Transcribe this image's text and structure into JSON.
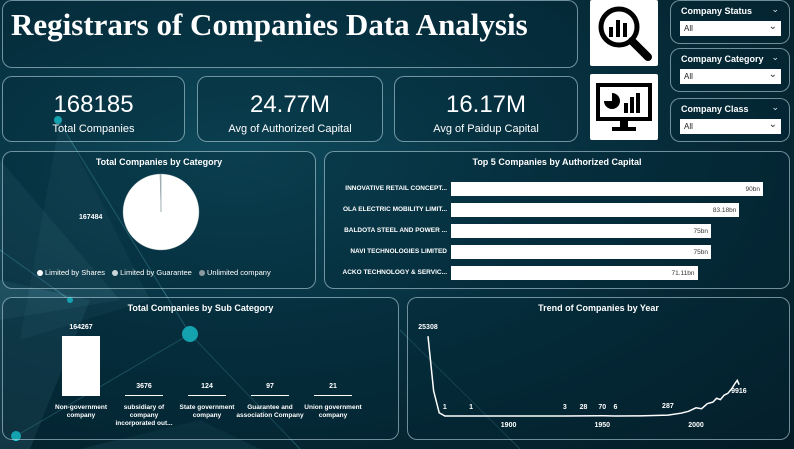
{
  "title": "Registrars of Companies Data Analysis",
  "slicers": [
    {
      "label": "Company Status",
      "value": "All"
    },
    {
      "label": "Company Category",
      "value": "All"
    },
    {
      "label": "Company Class",
      "value": "All"
    }
  ],
  "kpis": [
    {
      "value": "168185",
      "label": "Total Companies"
    },
    {
      "value": "24.77M",
      "label": "Avg of Authorized Capital"
    },
    {
      "value": "16.17M",
      "label": "Avg of Paidup Capital"
    }
  ],
  "colors": {
    "accent": "#ffffff",
    "background": "#07303f",
    "glow": "#1fe3f0"
  },
  "chart_data": [
    {
      "type": "pie",
      "title": "Total Companies by Category",
      "data_label": "167484",
      "slices": [
        {
          "name": "Limited by Shares",
          "value": 167484
        },
        {
          "name": "Limited by Guarantee",
          "value": 601
        },
        {
          "name": "Unlimited company",
          "value": 100
        }
      ],
      "legend_position": "bottom"
    },
    {
      "type": "bar",
      "orientation": "horizontal",
      "title": "Top 5 Companies by Authorized Capital",
      "categories": [
        "INNOVATIVE RETAIL CONCEPT...",
        "OLA ELECTRIC MOBILITY LIMIT...",
        "BALDOTA STEEL AND POWER ...",
        "NAVI TECHNOLOGIES LIMITED",
        "ACKO TECHNOLOGY & SERVIC..."
      ],
      "values": [
        90,
        83.18,
        75,
        75,
        71.11
      ],
      "labels": [
        "90bn",
        "83.18bn",
        "75bn",
        "75bn",
        "71.11bn"
      ],
      "xlim": [
        0,
        90
      ]
    },
    {
      "type": "bar",
      "title": "Total Companies by Sub Category",
      "categories": [
        "Non-government company",
        "subsidiary of company incorporated out...",
        "State government company",
        "Guarantee and association Company",
        "Union government company"
      ],
      "values": [
        164267,
        3676,
        124,
        97,
        21
      ],
      "labels": [
        "164267",
        "3676",
        "124",
        "97",
        "21"
      ]
    },
    {
      "type": "line",
      "title": "Trend of Companies by Year",
      "x_ticks": [
        "1900",
        "1950",
        "2000"
      ],
      "xlim": [
        1857,
        2024
      ],
      "points": [
        [
          1857,
          25308
        ],
        [
          1860,
          8000
        ],
        [
          1863,
          1000
        ],
        [
          1866,
          1
        ],
        [
          1870,
          0
        ],
        [
          1880,
          1
        ],
        [
          1890,
          0
        ],
        [
          1900,
          0
        ],
        [
          1912,
          1
        ],
        [
          1930,
          3
        ],
        [
          1940,
          28
        ],
        [
          1950,
          70
        ],
        [
          1957,
          6
        ],
        [
          1970,
          30
        ],
        [
          1985,
          287
        ],
        [
          1992,
          900
        ],
        [
          1996,
          1500
        ],
        [
          2000,
          2600
        ],
        [
          2003,
          2300
        ],
        [
          2006,
          3900
        ],
        [
          2009,
          4400
        ],
        [
          2011,
          5600
        ],
        [
          2013,
          5200
        ],
        [
          2015,
          6600
        ],
        [
          2017,
          7200
        ],
        [
          2019,
          8600
        ],
        [
          2021,
          10500
        ],
        [
          2022,
          11300
        ],
        [
          2023,
          9916
        ]
      ],
      "annotations": [
        {
          "year": 1857,
          "label": "25308"
        },
        {
          "year": 1866,
          "label": "1"
        },
        {
          "year": 1880,
          "label": "1"
        },
        {
          "year": 1930,
          "label": "3"
        },
        {
          "year": 1940,
          "label": "28"
        },
        {
          "year": 1950,
          "label": "70"
        },
        {
          "year": 1957,
          "label": "6"
        },
        {
          "year": 1985,
          "label": "287"
        },
        {
          "year": 2023,
          "label": "9916"
        }
      ],
      "ylim": [
        0,
        26000
      ]
    }
  ]
}
